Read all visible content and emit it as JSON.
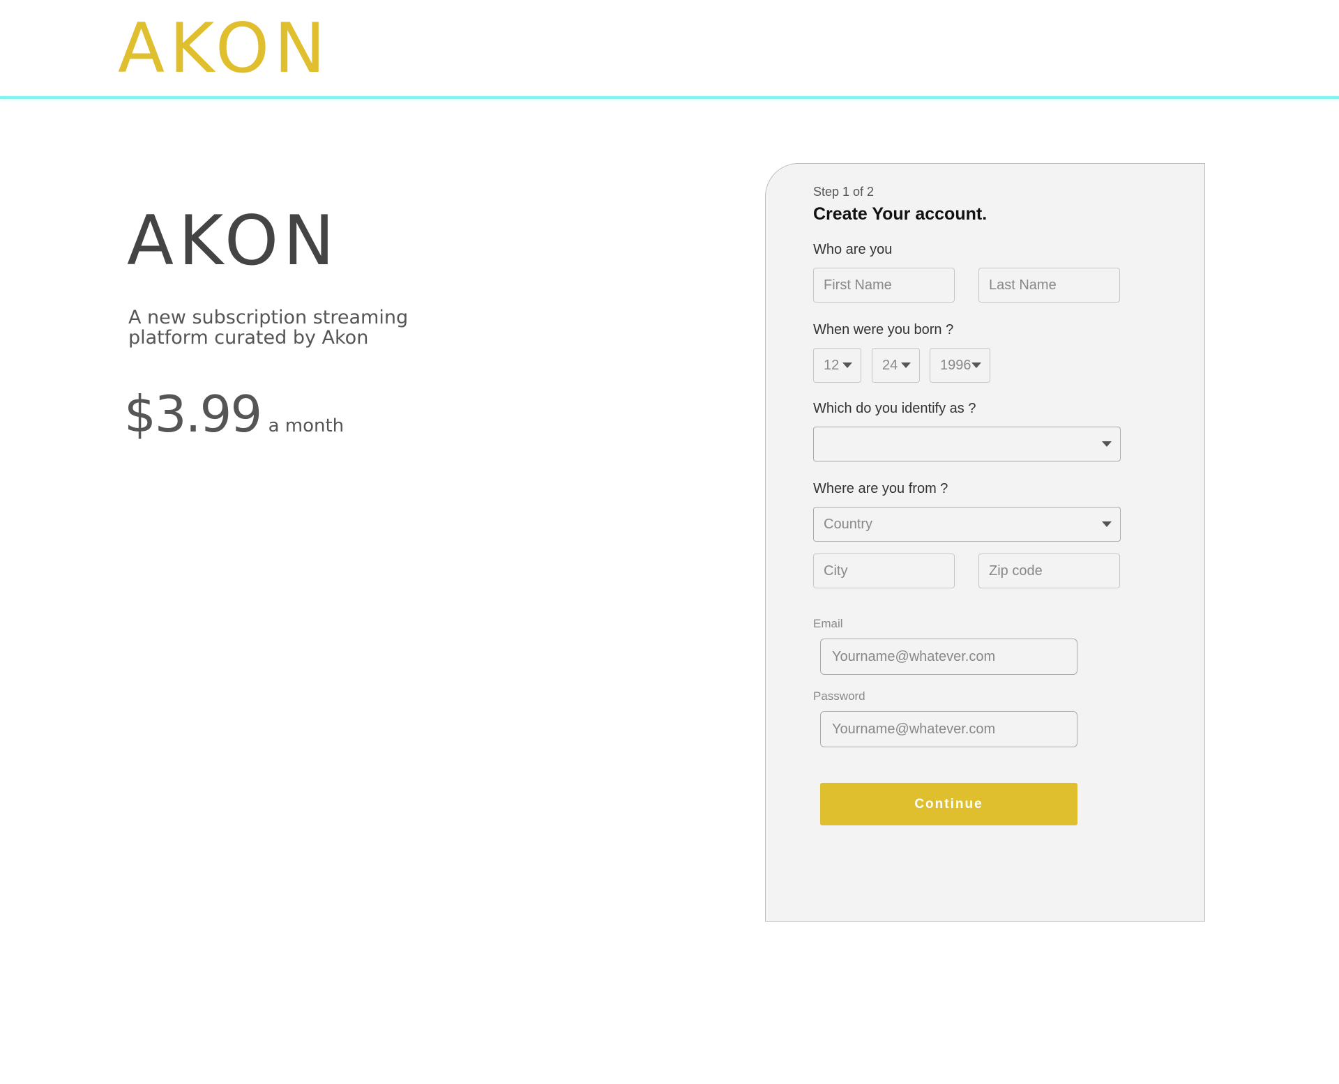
{
  "header": {
    "logo": "AKON"
  },
  "hero": {
    "title": "AKON",
    "description": "A new subscription streaming platform curated by Akon",
    "price": "$3.99",
    "price_period": "a month"
  },
  "form": {
    "step": "Step 1 of 2",
    "title": "Create Your account.",
    "who_label": "Who are you",
    "first_name_placeholder": "First Name",
    "last_name_placeholder": "Last Name",
    "born_label": "When were you born ?",
    "birth_month": "12",
    "birth_day": "24",
    "birth_year": "1996",
    "identify_label": "Which do you identify as ?",
    "identify_value": "",
    "from_label": "Where are you from ?",
    "country_placeholder": "Country",
    "city_placeholder": "City",
    "zip_placeholder": "Zip code",
    "email_label": "Email",
    "email_placeholder": "Yourname@whatever.com",
    "password_label": "Password",
    "password_placeholder": "Yourname@whatever.com",
    "continue_label": "Continue"
  },
  "colors": {
    "brand": "#e0bf2e",
    "header_rule": "#7ff5f0",
    "card_bg": "#f3f3f3"
  }
}
